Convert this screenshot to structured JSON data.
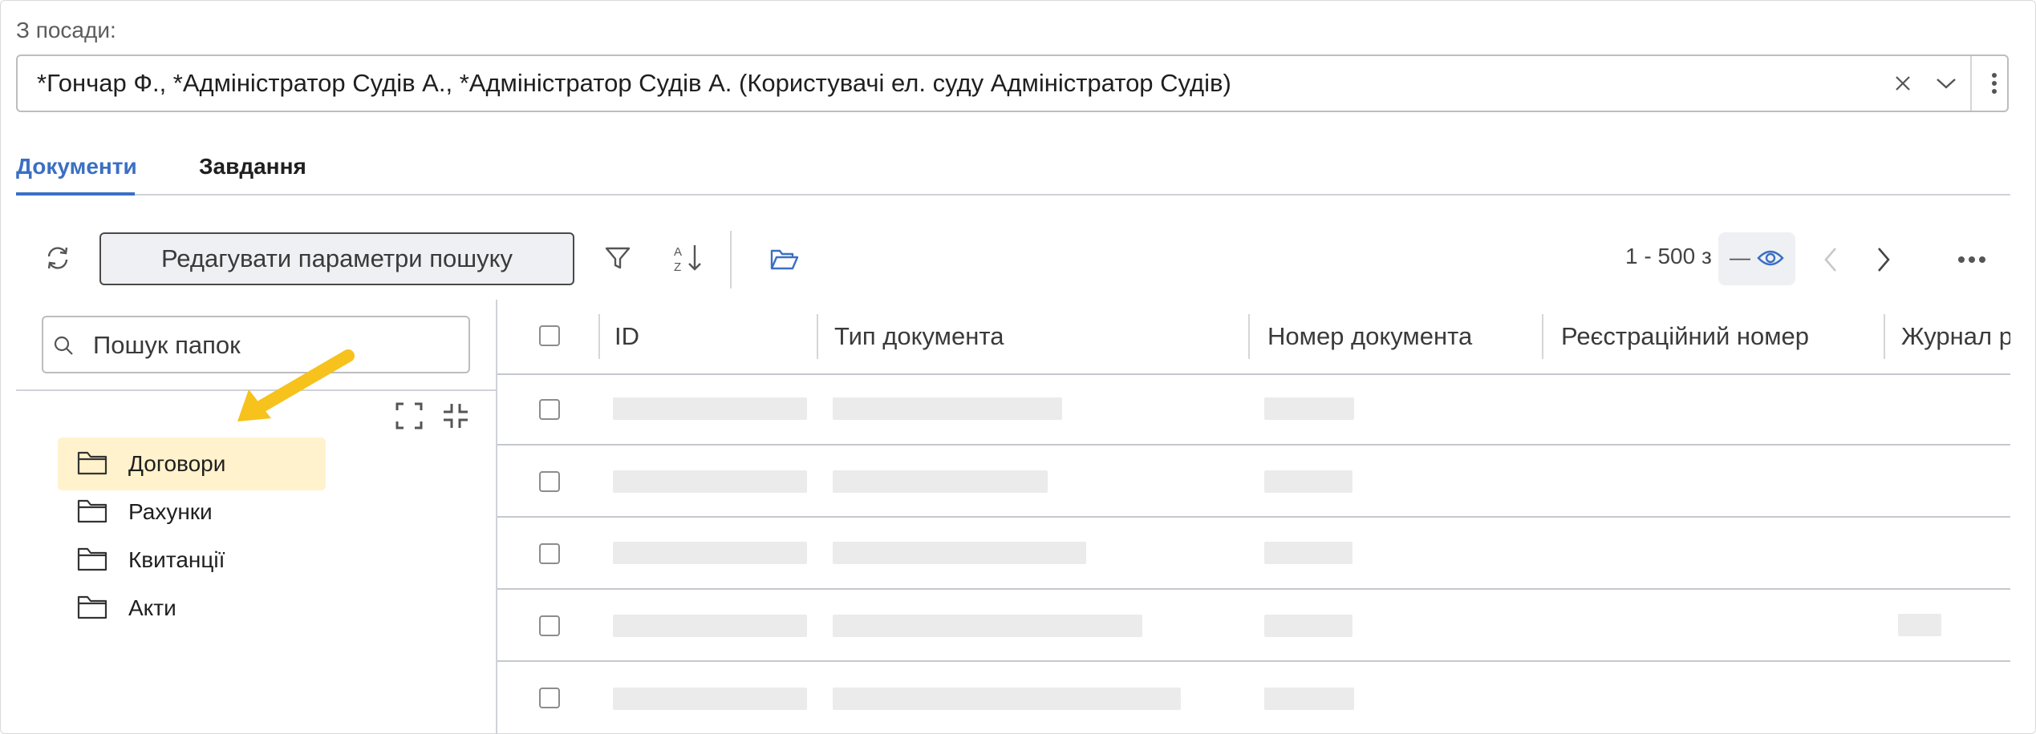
{
  "position_filter": {
    "label": "З посади:",
    "value": "*Гончар Ф., *Адміністратор Судів А., *Адміністратор Судів А. (Користувачі ел. суду Адміністратор Судів)"
  },
  "tabs": [
    {
      "label": "Документи",
      "active": true
    },
    {
      "label": "Завдання",
      "active": false
    }
  ],
  "toolbar": {
    "edit_search_label": "Редагувати параметри пошуку",
    "pager_text": "1 - 500 з",
    "pager_total_placeholder": "—"
  },
  "folder_search": {
    "placeholder": "Пошук папок",
    "value": ""
  },
  "folders": [
    {
      "label": "Договори",
      "selected": true
    },
    {
      "label": "Рахунки",
      "selected": false
    },
    {
      "label": "Квитанції",
      "selected": false
    },
    {
      "label": "Акти",
      "selected": false
    }
  ],
  "grid": {
    "columns": [
      "ID",
      "Тип документа",
      "Номер документа",
      "Реєстраційний номер",
      "Журнал р"
    ],
    "rows_loading": 5
  },
  "colors": {
    "accent": "#3b6fc3",
    "selected_folder_bg": "#fff2cc",
    "annotation_arrow": "#f6c21b",
    "skeleton": "#ebebeb"
  },
  "icons": [
    "clear-icon",
    "chevron-down-icon",
    "more-vertical-icon",
    "refresh-icon",
    "filter-icon",
    "sort-az-icon",
    "folder-open-icon",
    "eye-icon",
    "chevron-left-icon",
    "chevron-right-icon",
    "more-horizontal-icon",
    "search-icon",
    "expand-icon",
    "collapse-icon",
    "folder-icon"
  ]
}
